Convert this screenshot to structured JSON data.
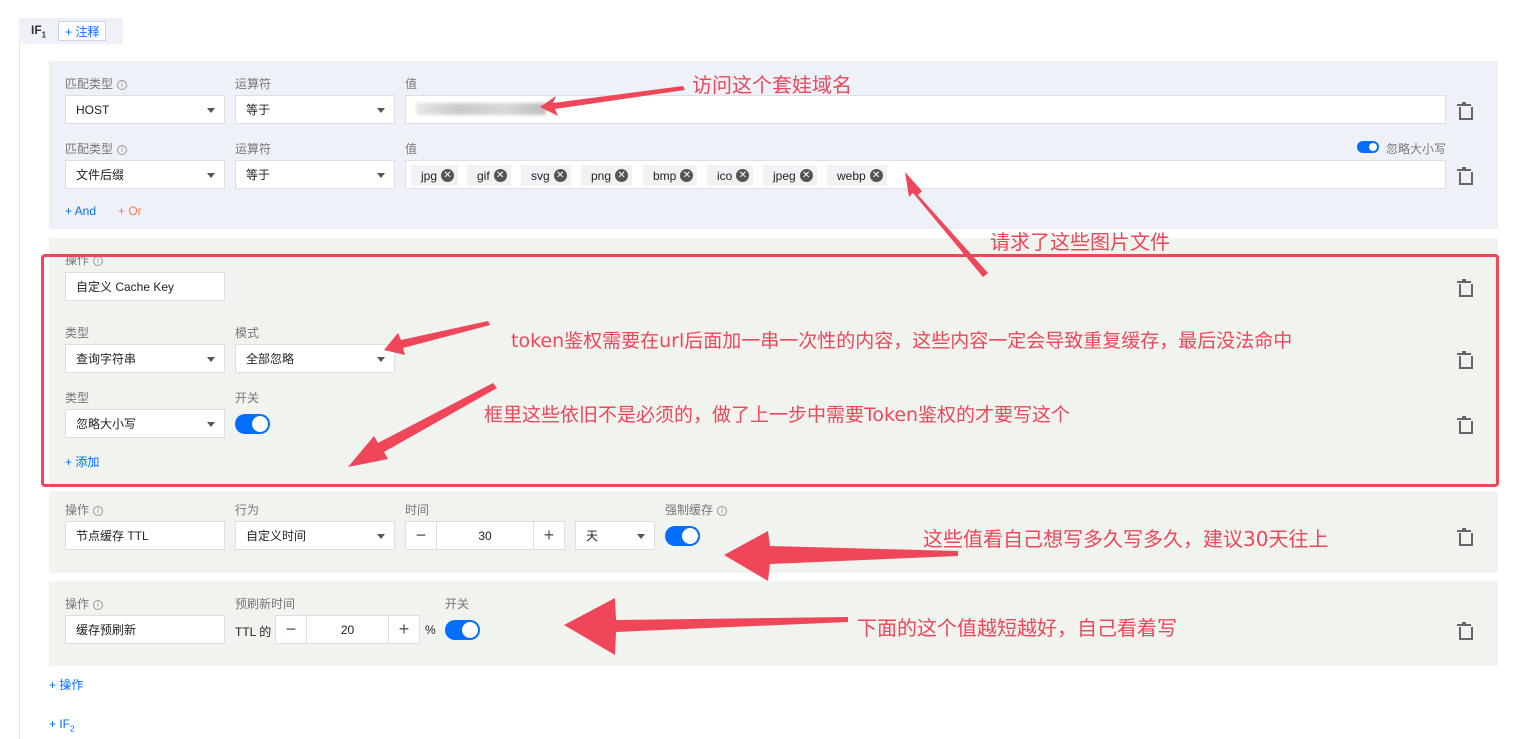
{
  "if1": {
    "label": "IF",
    "sub": "1",
    "note_button": "+ 注释"
  },
  "conditions": {
    "match_type_label": "匹配类型",
    "operator_label": "运算符",
    "value_label": "值",
    "row1": {
      "match_type": "HOST",
      "operator": "等于"
    },
    "row2": {
      "match_type": "文件后缀",
      "operator": "等于",
      "ignore_case_label": "忽略大小写",
      "tags": [
        "jpg",
        "gif",
        "svg",
        "png",
        "bmp",
        "ico",
        "jpeg",
        "webp"
      ]
    },
    "and_link": "+ And",
    "or_link": "+ Or"
  },
  "action1": {
    "op_label": "操作",
    "op_value": "自定义 Cache Key",
    "type_label": "类型",
    "mode_label": "模式",
    "type1_value": "查询字符串",
    "mode_value": "全部忽略",
    "type2_label": "类型",
    "switch_label": "开关",
    "type2_value": "忽略大小写",
    "add_link": "+ 添加"
  },
  "action2": {
    "op_label": "操作",
    "op_value": "节点缓存 TTL",
    "behavior_label": "行为",
    "behavior_value": "自定义时间",
    "time_label": "时间",
    "time_value": "30",
    "unit_value": "天",
    "force_label": "强制缓存"
  },
  "action3": {
    "op_label": "操作",
    "op_value": "缓存预刷新",
    "prefresh_label": "预刷新时间",
    "switch_label": "开关",
    "ttl_prefix": "TTL 的",
    "value": "20",
    "suffix": "%"
  },
  "add_action_link": "+ 操作",
  "add_if2_link": "+ IF",
  "add_if2_sub": "2",
  "annotations": {
    "a1": "访问这个套娃域名",
    "a2": "请求了这些图片文件",
    "a3": "token鉴权需要在url后面加一串一次性的内容，这些内容一定会导致重复缓存，最后没法命中",
    "a4": "框里这些依旧不是必须的，做了上一步中需要Token鉴权的才要写这个",
    "a5": "这些值看自己想写多久写多久，建议30天往上",
    "a6": "下面的这个值越短越好，自己看着写"
  },
  "colors": {
    "accent": "#006eff",
    "annotation": "#f0465a",
    "or": "#ff7a45"
  }
}
